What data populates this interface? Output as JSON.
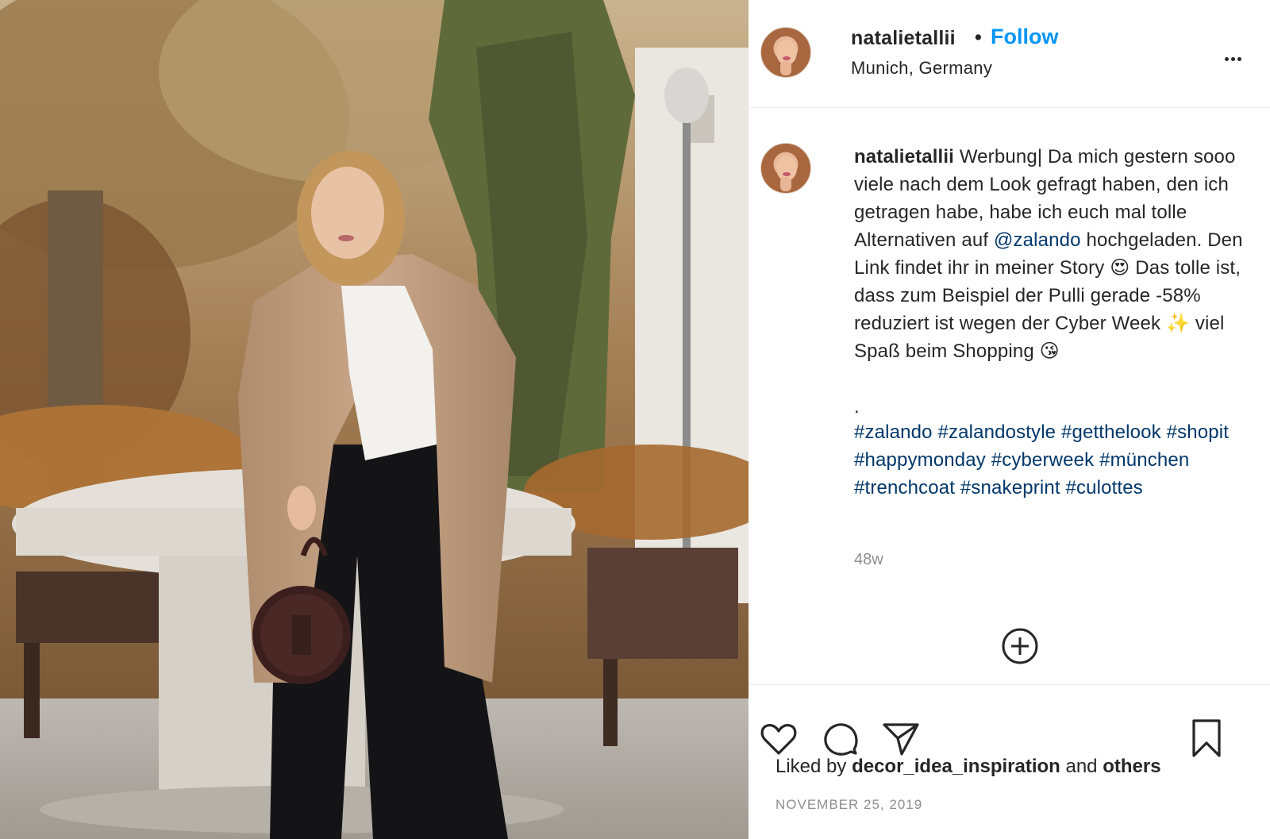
{
  "post": {
    "username": "natalietallii",
    "dot": "•",
    "follow_label": "Follow",
    "location": "Munich, Germany",
    "caption_user": "natalietallii",
    "caption_part1": " Werbung| Da mich gestern sooo viele nach dem Look gefragt haben, den ich getragen habe, habe ich euch mal tolle Alternativen auf ",
    "mention": "@zalando",
    "caption_part2": " hochgeladen. Den Link findet ihr in meiner Story 😍 Das tolle ist, dass zum Beispiel der Pulli gerade -58% reduziert ist wegen der Cyber Week ✨ viel Spaß beim Shopping 😘",
    "caption_dot": ".",
    "hashtags": [
      "#zalando",
      "#zalandostyle",
      "#getthelook",
      "#shopit",
      "#happymonday",
      "#cyberweek",
      "#münchen",
      "#trenchcoat",
      "#snakeprint",
      "#culottes"
    ],
    "age": "48w",
    "liked_by_prefix": "Liked by ",
    "liked_by_user": "decor_idea_inspiration",
    "liked_by_and": " and ",
    "liked_by_others": "others",
    "date": "NOVEMBER 25, 2019"
  },
  "icons": {
    "more": "more-options-icon",
    "load_more": "plus-circle-icon",
    "like": "heart-icon",
    "comment": "comment-icon",
    "share": "paper-plane-icon",
    "save": "bookmark-icon"
  },
  "colors": {
    "follow": "#0095f6",
    "link": "#00376b",
    "muted": "#8e8e8e",
    "text": "#262626"
  }
}
